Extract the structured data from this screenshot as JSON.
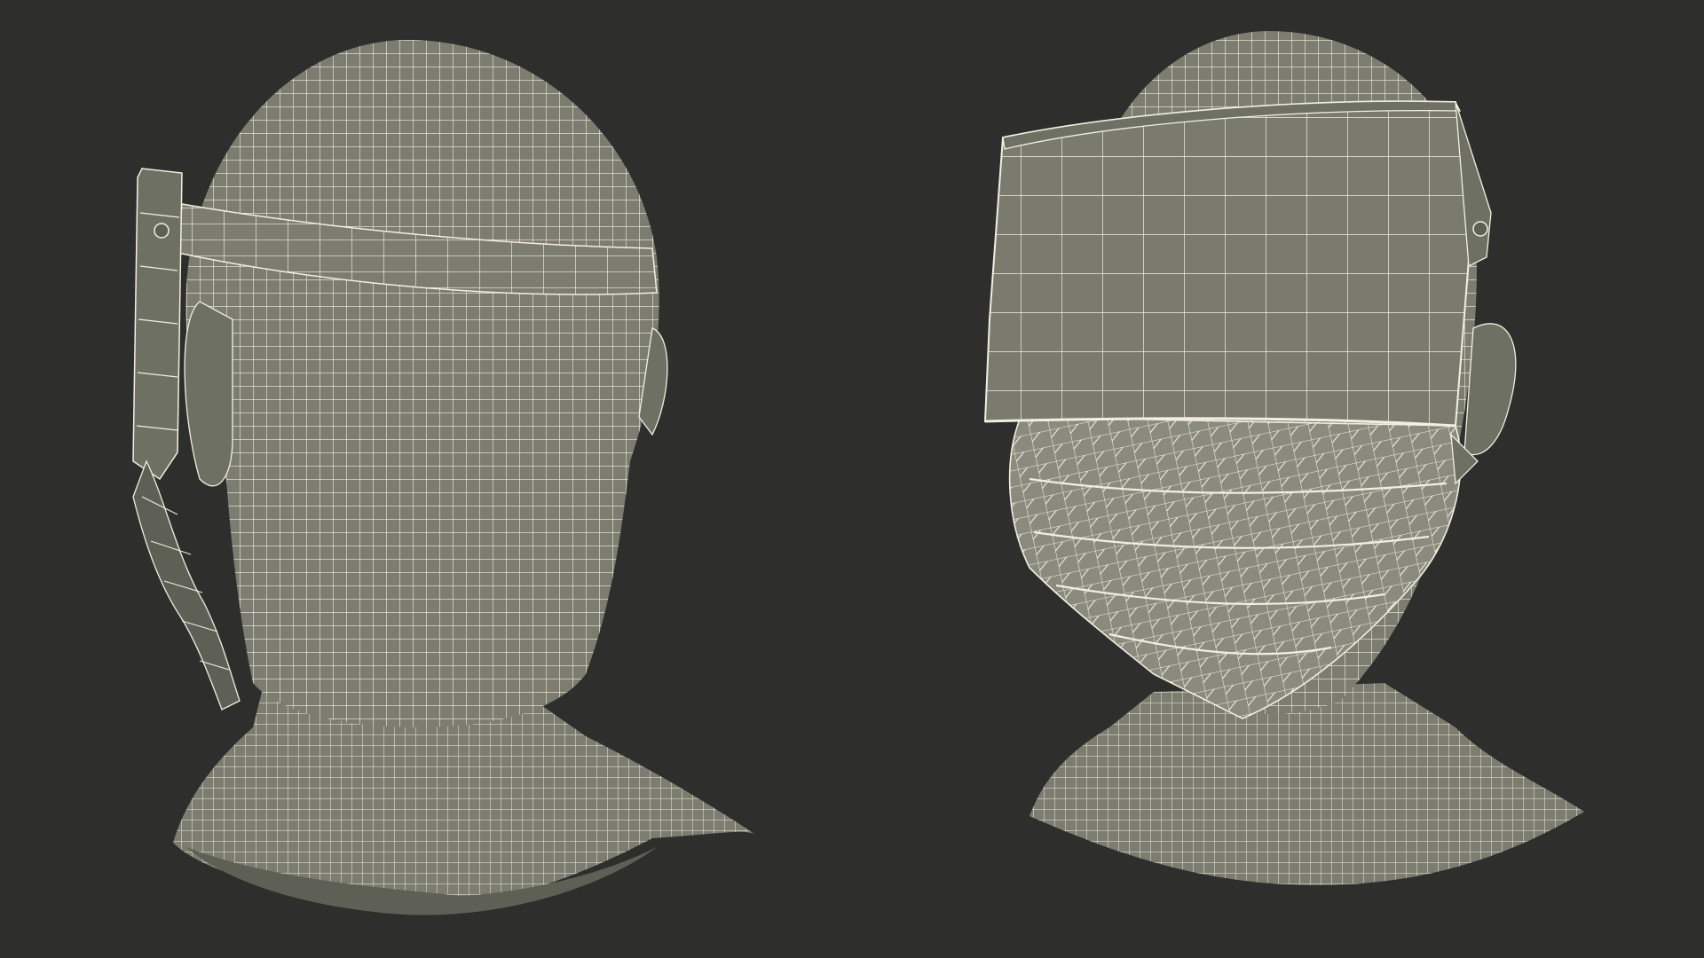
{
  "scene": {
    "background": "#2e2e2c",
    "mesh_fill": "#7c7d70",
    "mesh_fill_dark": "#5f6055",
    "wire_color": "#f1efe0",
    "views": [
      {
        "subject": "head-back-view",
        "wearing": [
          "face-shield-band",
          "surgical-mask-straps"
        ]
      },
      {
        "subject": "head-front-view",
        "wearing": [
          "face-shield-visor",
          "surgical-mask"
        ]
      }
    ]
  }
}
